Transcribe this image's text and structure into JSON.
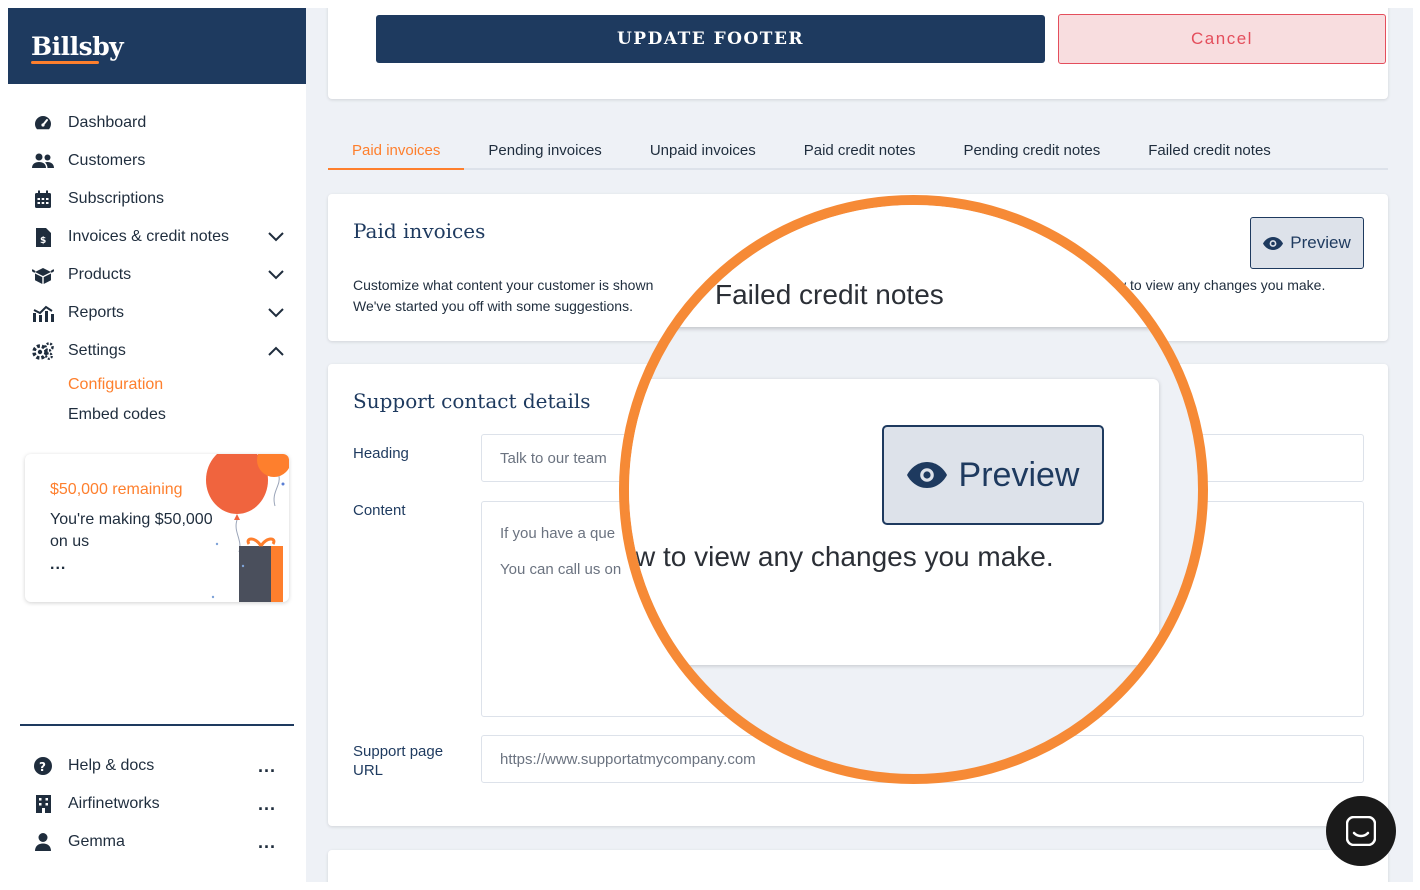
{
  "brand": {
    "logo": "Billsby",
    "accent": "#fe7f2d",
    "navy": "#1e3a5f"
  },
  "sidebar": {
    "items": [
      {
        "label": "Dashboard",
        "icon": "dashboard-icon"
      },
      {
        "label": "Customers",
        "icon": "users-icon"
      },
      {
        "label": "Subscriptions",
        "icon": "calendar-icon"
      },
      {
        "label": "Invoices & credit notes",
        "icon": "invoice-icon",
        "chevron": "down"
      },
      {
        "label": "Products",
        "icon": "products-icon",
        "chevron": "down"
      },
      {
        "label": "Reports",
        "icon": "reports-icon",
        "chevron": "down"
      },
      {
        "label": "Settings",
        "icon": "gears-icon",
        "chevron": "up"
      }
    ],
    "settings_sub": [
      {
        "label": "Configuration",
        "active": true
      },
      {
        "label": "Embed codes",
        "active": false
      }
    ],
    "promo": {
      "amount": "$50,000 remaining",
      "text": "You're making $50,000 on us",
      "more": "..."
    },
    "bottom": [
      {
        "label": "Help & docs",
        "icon": "help-icon",
        "menu": "..."
      },
      {
        "label": "Airfinetworks",
        "icon": "building-icon",
        "menu": "..."
      },
      {
        "label": "Gemma",
        "icon": "user-icon",
        "menu": "..."
      }
    ]
  },
  "top_actions": {
    "update_label": "UPDATE FOOTER",
    "cancel_label": "Cancel"
  },
  "tabs": [
    {
      "label": "Paid invoices",
      "active": true
    },
    {
      "label": "Pending invoices",
      "active": false
    },
    {
      "label": "Unpaid invoices",
      "active": false
    },
    {
      "label": "Paid credit notes",
      "active": false
    },
    {
      "label": "Pending credit notes",
      "active": false
    },
    {
      "label": "Failed credit notes",
      "active": false
    }
  ],
  "paid_invoices": {
    "title": "Paid invoices",
    "desc_line1_start": "Customize what content your customer is shown",
    "desc_line1_end": "w to view any changes you make.",
    "desc_line2": "We've started you off with some suggestions.",
    "preview_label": "Preview"
  },
  "support": {
    "title": "Support contact details",
    "heading_label": "Heading",
    "heading_value": "Talk to our team",
    "content_label": "Content",
    "content_line1": "If you have a que",
    "content_line2": "You can call us on",
    "url_label": "Support page URL",
    "url_placeholder": "https://www.supportatmycompany.com"
  },
  "zoom": {
    "title": "Failed credit notes",
    "preview_label": "Preview",
    "desc": "w to view any changes you make."
  }
}
